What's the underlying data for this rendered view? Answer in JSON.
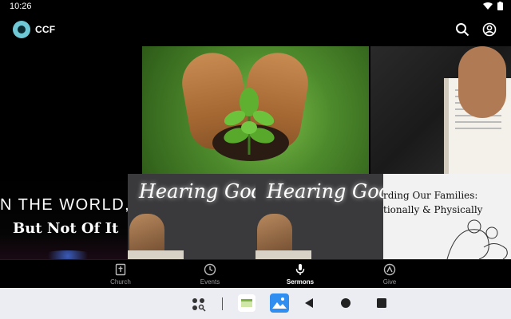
{
  "status_bar": {
    "time": "10:26"
  },
  "app_bar": {
    "title": "CCF"
  },
  "hero": {
    "slides_count": 2,
    "active_slide": 1
  },
  "cards": {
    "world": {
      "line1": "N THE WORLD,",
      "line2": "But Not Of It"
    },
    "hearing_1": {
      "title": "Hearing God"
    },
    "hearing_2": {
      "title": "Hearing God"
    },
    "families": {
      "line1": "rding Our Families:",
      "line2": "tionally & Physically"
    }
  },
  "bottom_nav": {
    "items": [
      {
        "label": "Church",
        "icon": "cross-book-icon"
      },
      {
        "label": "Events",
        "icon": "clock-icon"
      },
      {
        "label": "Sermons",
        "icon": "microphone-icon"
      },
      {
        "label": "Give",
        "icon": "give-icon"
      }
    ],
    "active": "Sermons"
  },
  "colors": {
    "background": "#000000",
    "system_nav": "#ececf3",
    "logo": "#6fc8d6"
  }
}
